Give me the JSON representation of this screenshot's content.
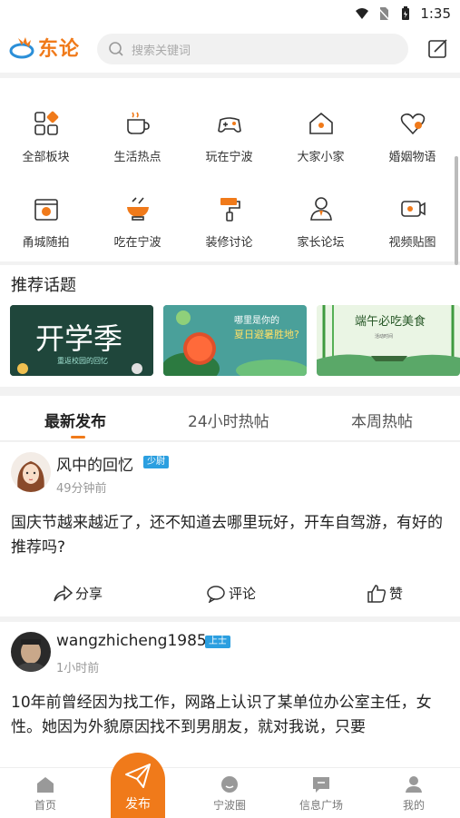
{
  "status_bar": {
    "time": "1:35"
  },
  "header": {
    "logo_text": "东论",
    "search_placeholder": "搜索关键词"
  },
  "categories": [
    {
      "label": "全部板块",
      "icon": "grid-icon"
    },
    {
      "label": "生活热点",
      "icon": "coffee-cup-icon"
    },
    {
      "label": "玩在宁波",
      "icon": "gamepad-icon"
    },
    {
      "label": "大家小家",
      "icon": "house-icon"
    },
    {
      "label": "婚姻物语",
      "icon": "heart-icon"
    },
    {
      "label": "甬城随拍",
      "icon": "camera-icon"
    },
    {
      "label": "吃在宁波",
      "icon": "food-bowl-icon"
    },
    {
      "label": "装修讨论",
      "icon": "paint-roller-icon"
    },
    {
      "label": "家长论坛",
      "icon": "parent-icon"
    },
    {
      "label": "视频贴图",
      "icon": "video-icon"
    }
  ],
  "topics": {
    "title": "推荐话题",
    "cards": [
      {
        "title": "开学季",
        "subtitle": "重返校园的回忆"
      },
      {
        "title": "哪里是你的",
        "subtitle": "夏日避暑胜地?"
      },
      {
        "title": "端午必吃美食",
        "subtitle": "活动时间"
      }
    ]
  },
  "tabs": [
    {
      "label": "最新发布",
      "active": true
    },
    {
      "label": "24小时热帖",
      "active": false
    },
    {
      "label": "本周热帖",
      "active": false
    }
  ],
  "posts": [
    {
      "username": "风中的回忆",
      "badge": "少尉",
      "time": "49分钟前",
      "content": "国庆节越来越近了，还不知道去哪里玩好，开车自驾游，有好的推荐吗?",
      "share_label": "分享",
      "comment_label": "评论",
      "like_label": "赞"
    },
    {
      "username": "wangzhicheng1985",
      "badge": "上士",
      "time": "1小时前",
      "content": "10年前曾经因为找工作，网路上认识了某单位办公室主任，女性。她因为外貌原因找不到男朋友，就对我说，只要"
    }
  ],
  "bottom_nav": [
    {
      "label": "首页",
      "icon": "home-icon"
    },
    {
      "label": "发布",
      "icon": "paper-plane-icon"
    },
    {
      "label": "宁波圈",
      "icon": "chat-bubble-icon"
    },
    {
      "label": "信息广场",
      "icon": "message-icon"
    },
    {
      "label": "我的",
      "icon": "user-icon"
    }
  ],
  "colors": {
    "accent": "#f07a1a",
    "badge": "#2b9fe0"
  }
}
